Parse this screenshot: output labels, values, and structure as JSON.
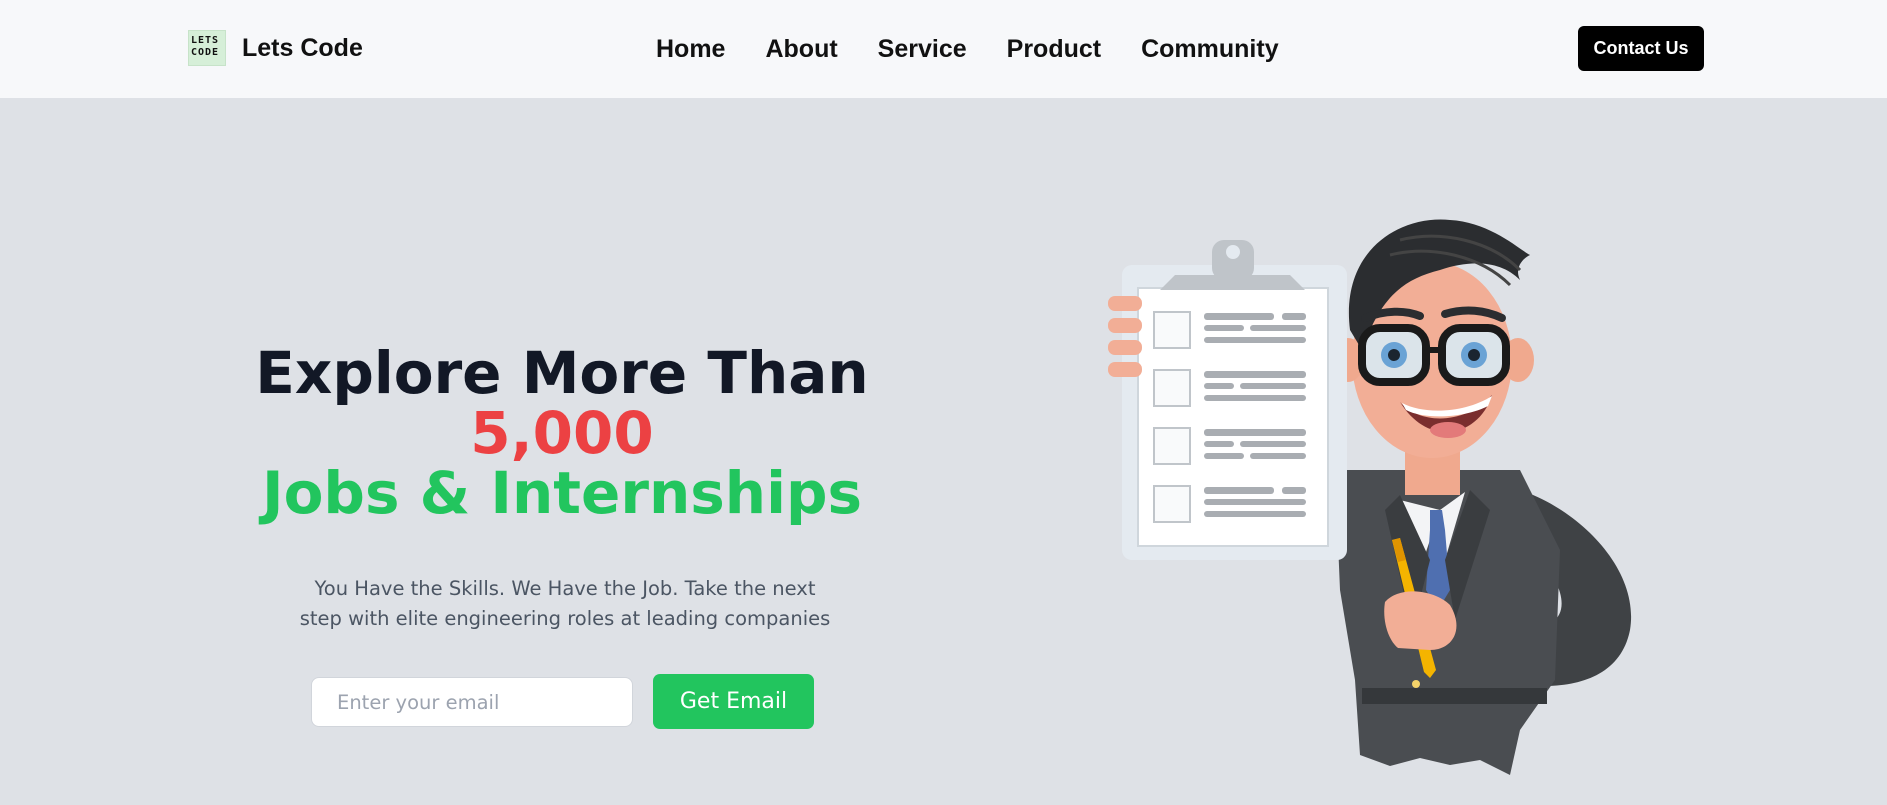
{
  "header": {
    "brand": {
      "logo_text_line1": "LETS",
      "logo_text_line2": "CODE",
      "name": "Lets Code"
    },
    "nav": [
      {
        "label": "Home"
      },
      {
        "label": "About"
      },
      {
        "label": "Service"
      },
      {
        "label": "Product"
      },
      {
        "label": "Community"
      }
    ],
    "contact_label": "Contact Us"
  },
  "hero": {
    "title_line1": "Explore More Than",
    "title_highlight": "5,000",
    "title_line3": "Jobs & Internships",
    "subtitle_line1": "You Have the Skills. We Have the Job. Take the next",
    "subtitle_line2": "step with elite engineering roles at leading companies",
    "email_placeholder": "Enter your email",
    "email_value": "",
    "cta_label": "Get Email"
  },
  "illustration": {
    "icon": "businessman-with-clipboard-icon"
  },
  "colors": {
    "header_bg": "#f7f8fa",
    "page_bg": "#dee1e6",
    "title_dark": "#121826",
    "highlight_red": "#ec4143",
    "accent_green": "#22c55e",
    "contact_bg": "#000000"
  }
}
